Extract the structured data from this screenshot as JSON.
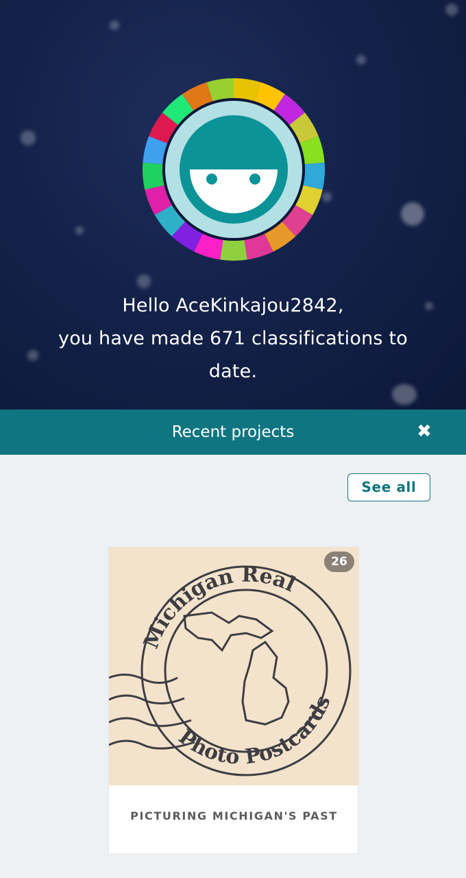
{
  "greeting": {
    "line1": "Hello AceKinkajou2842,",
    "line2": "you have made 671 classifications to",
    "line3": "date."
  },
  "recent_projects": {
    "title": "Recent projects",
    "close_icon": "close-icon",
    "see_all_label": "See all"
  },
  "projects": [
    {
      "title": "PICTURING MICHIGAN'S PAST",
      "count_badge": "26",
      "image_text_top": "Michigan Real",
      "image_text_bottom": "Photo Postcards"
    }
  ],
  "colors": {
    "hero_bg": "#14224a",
    "teal_bar": "#0f7581",
    "page_bg": "#edf1f4",
    "avatar_teal": "#0b9398",
    "avatar_light": "#b3e0e4",
    "badge_bg": "#8c8176",
    "postcard_bg": "#f4e3cc"
  },
  "avatar_ring_colors": [
    "#e8c300",
    "#ffc400",
    "#c028e0",
    "#c8c838",
    "#88e020",
    "#30a8d8",
    "#e0d030",
    "#e04090",
    "#e89828",
    "#e03898",
    "#90d040",
    "#ff20c8",
    "#8020e0",
    "#30b0c8",
    "#e020a8",
    "#20d060",
    "#40a0f0",
    "#e01850",
    "#20e878",
    "#e07818",
    "#98d030"
  ]
}
